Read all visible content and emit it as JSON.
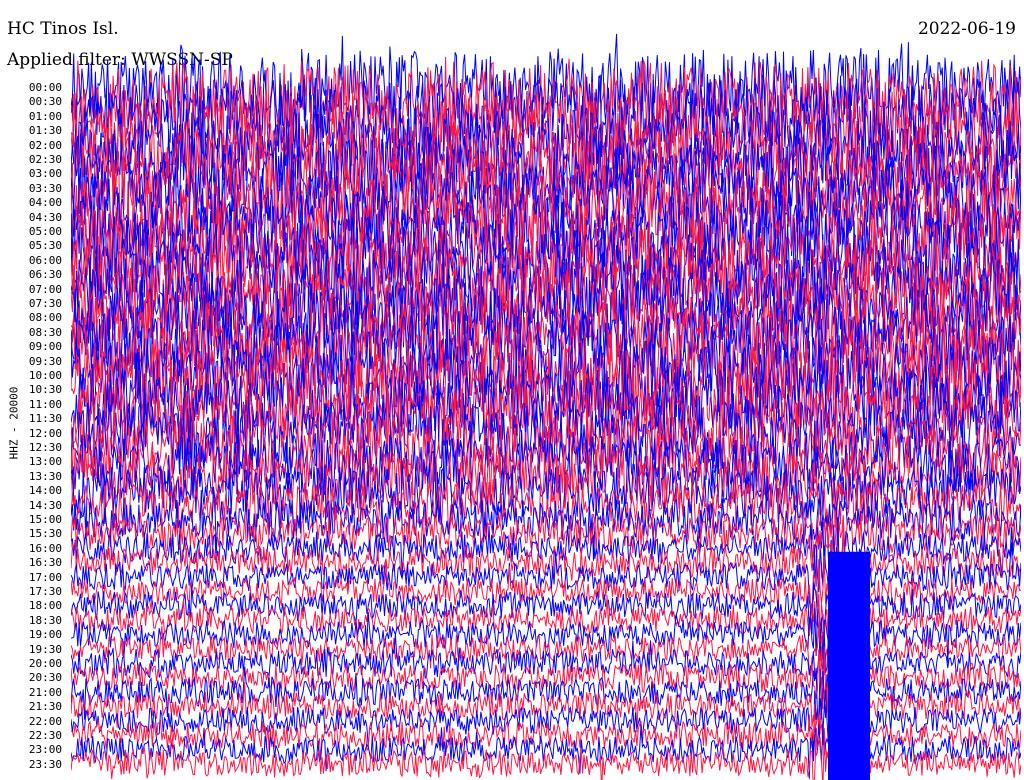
{
  "header": {
    "station": "HC Tinos Isl.",
    "filter": "Applied filter: WWSSN-SP",
    "date": "2022-06-19"
  },
  "axis": {
    "ylabel": "HHZ - 20000"
  },
  "chart_data": {
    "type": "line",
    "title": "HC Tinos Isl.",
    "subtitle": "Applied filter: WWSSN-SP",
    "date": "2022-06-19",
    "ylabel": "HHZ - 20000",
    "row_labels": [
      "00:00",
      "00:30",
      "01:00",
      "01:30",
      "02:00",
      "02:30",
      "03:00",
      "03:30",
      "04:00",
      "04:30",
      "05:00",
      "05:30",
      "06:00",
      "06:30",
      "07:00",
      "07:30",
      "08:00",
      "08:30",
      "09:00",
      "09:30",
      "10:00",
      "10:30",
      "11:00",
      "11:30",
      "12:00",
      "12:30",
      "13:00",
      "13:30",
      "14:00",
      "14:30",
      "15:00",
      "15:30",
      "16:00",
      "16:30",
      "17:00",
      "17:30",
      "18:00",
      "18:30",
      "19:00",
      "19:30",
      "20:00",
      "20:30",
      "21:00",
      "21:30",
      "22:00",
      "22:30",
      "23:00",
      "23:30"
    ],
    "row_duration_minutes": 30,
    "noise_amplitude_per_row": [
      2.6,
      2.6,
      2.6,
      2.6,
      2.6,
      2.6,
      2.6,
      2.6,
      2.6,
      2.6,
      2.6,
      2.6,
      2.6,
      2.6,
      2.6,
      2.6,
      2.6,
      2.6,
      2.6,
      2.6,
      2.6,
      2.6,
      2.4,
      2.3,
      2.2,
      2.1,
      2.0,
      1.9,
      1.8,
      1.6,
      1.4,
      1.2,
      1.0,
      1.0,
      0.9,
      0.9,
      0.9,
      0.9,
      0.9,
      0.9,
      0.9,
      0.9,
      0.9,
      0.9,
      0.9,
      0.9,
      0.9,
      0.9
    ],
    "series_colors": [
      "#0000ff",
      "#ff1744"
    ],
    "grid": false,
    "legend": "none",
    "event": {
      "start_row": "16:00",
      "end_row": "23:30",
      "minute_in_row": 24,
      "color": "#0000ff"
    }
  }
}
